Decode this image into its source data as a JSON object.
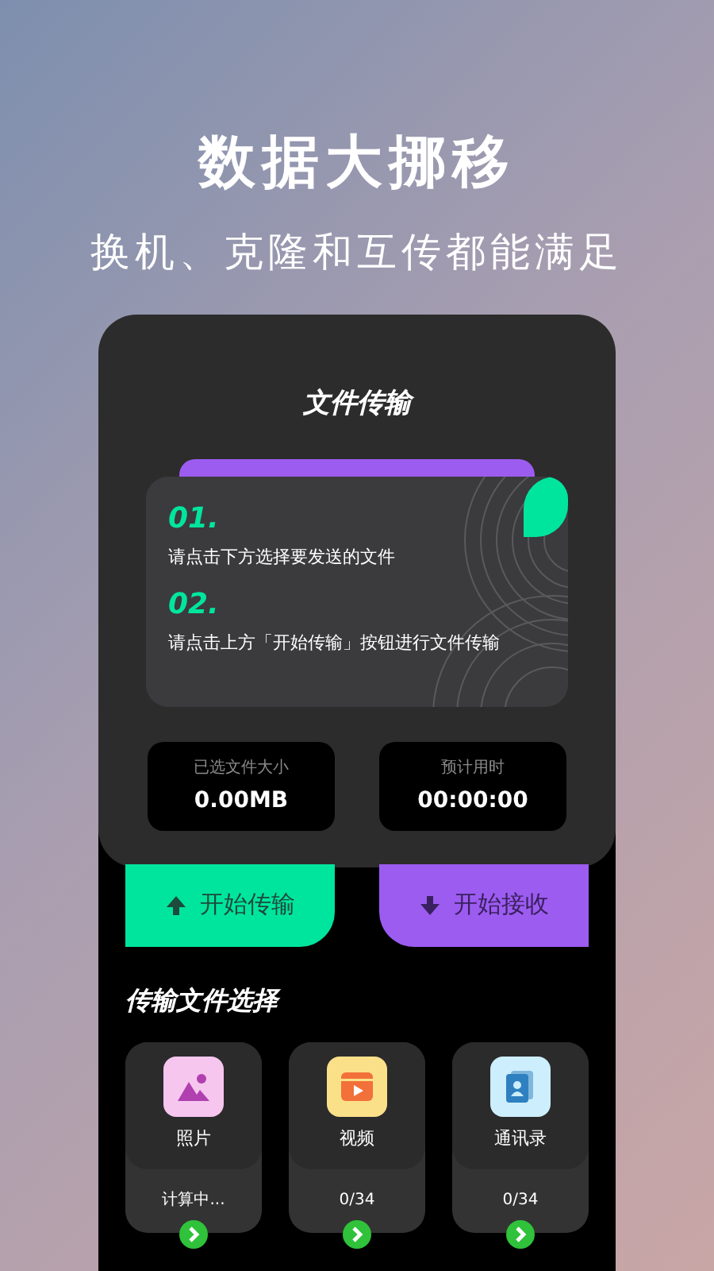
{
  "headline": "数据大挪移",
  "subtitle": "换机、克隆和互传都能满足",
  "screen_title": "文件传输",
  "steps": [
    {
      "number": "01.",
      "text": "请点击下方选择要发送的文件"
    },
    {
      "number": "02.",
      "text": "请点击上方「开始传输」按钮进行文件传输"
    }
  ],
  "stats": [
    {
      "label": "已选文件大小",
      "value": "0.00MB"
    },
    {
      "label": "预计用时",
      "value": "00:00:00"
    }
  ],
  "actions": [
    {
      "kind": "send",
      "label": "开始传输"
    },
    {
      "kind": "receive",
      "label": "开始接收"
    }
  ],
  "section_title": "传输文件选择",
  "file_types": [
    {
      "kind": "photo",
      "label": "照片",
      "count": "计算中..."
    },
    {
      "kind": "video",
      "label": "视频",
      "count": "0/34"
    },
    {
      "kind": "contacts",
      "label": "通讯录",
      "count": "0/34"
    }
  ]
}
